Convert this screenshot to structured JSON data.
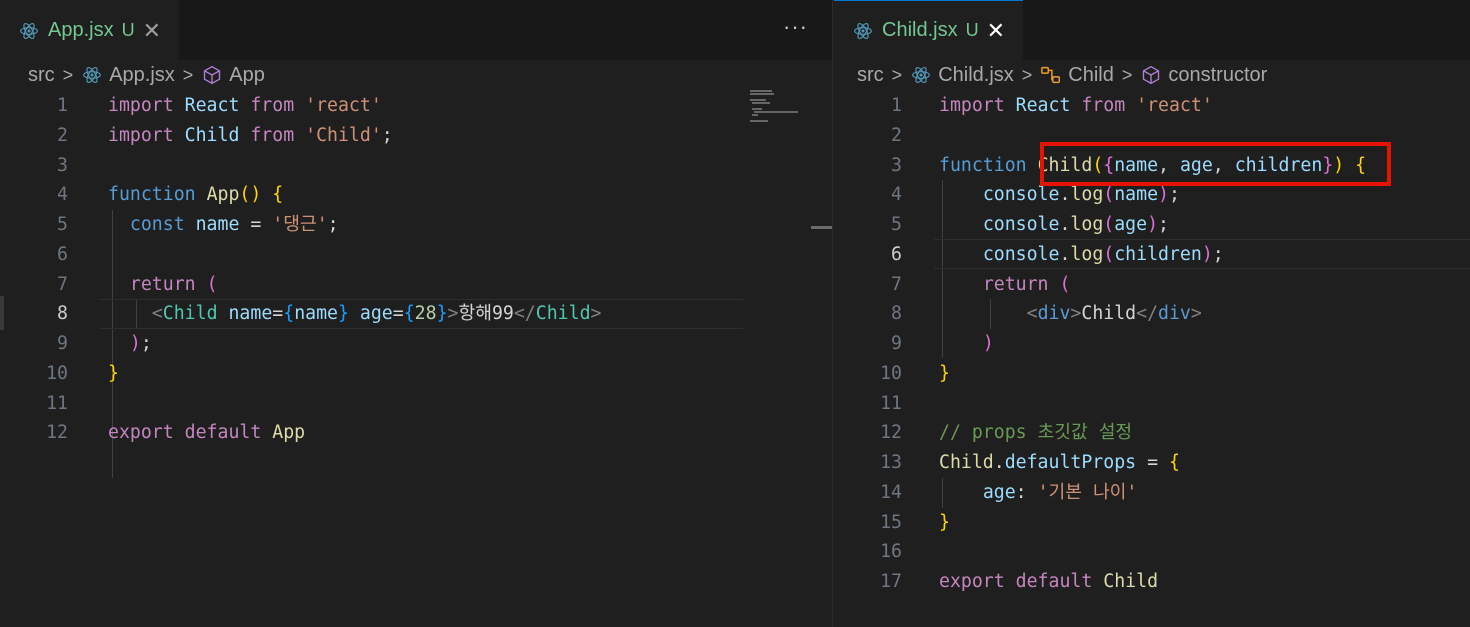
{
  "left": {
    "tab": {
      "name": "App.jsx",
      "status": "U",
      "close": "✕"
    },
    "more": "···",
    "breadcrumb": {
      "folder": "src",
      "file": "App.jsx",
      "symbol": "App"
    },
    "lines": [
      {
        "n": "1"
      },
      {
        "n": "2"
      },
      {
        "n": "3"
      },
      {
        "n": "4"
      },
      {
        "n": "5"
      },
      {
        "n": "6"
      },
      {
        "n": "7"
      },
      {
        "n": "8"
      },
      {
        "n": "9"
      },
      {
        "n": "10"
      },
      {
        "n": "11"
      },
      {
        "n": "12"
      }
    ],
    "code": {
      "l1": [
        "import",
        "React",
        "from",
        "'react'"
      ],
      "l2": [
        "import",
        "Child",
        "from",
        "'Child'",
        ";"
      ],
      "l4": [
        "function",
        "App",
        "()",
        "{"
      ],
      "l5": [
        "const",
        "name",
        "=",
        "'댕근'",
        ";"
      ],
      "l7": [
        "return",
        "("
      ],
      "l8": [
        "<",
        "Child",
        "name",
        "=",
        "{",
        "name",
        "}",
        "age",
        "=",
        "{",
        "28",
        "}",
        ">",
        "항해99",
        "</",
        "Child",
        ">"
      ],
      "l9": [
        ")",
        ";"
      ],
      "l10": [
        "}"
      ],
      "l12": [
        "export",
        "default",
        "App"
      ]
    }
  },
  "right": {
    "tab": {
      "name": "Child.jsx",
      "status": "U",
      "close": "✕"
    },
    "breadcrumb": {
      "folder": "src",
      "file": "Child.jsx",
      "symbol1": "Child",
      "symbol2": "constructor"
    },
    "lines": [
      {
        "n": "1"
      },
      {
        "n": "2"
      },
      {
        "n": "3"
      },
      {
        "n": "4"
      },
      {
        "n": "5"
      },
      {
        "n": "6"
      },
      {
        "n": "7"
      },
      {
        "n": "8"
      },
      {
        "n": "9"
      },
      {
        "n": "10"
      },
      {
        "n": "11"
      },
      {
        "n": "12"
      },
      {
        "n": "13"
      },
      {
        "n": "14"
      },
      {
        "n": "15"
      },
      {
        "n": "16"
      },
      {
        "n": "17"
      }
    ],
    "code": {
      "l1": [
        "import",
        "React",
        "from",
        "'react'"
      ],
      "l3": [
        "function",
        "Child",
        "(",
        "{",
        "name",
        ", ",
        "age",
        ", ",
        "children",
        "}",
        ")",
        "{"
      ],
      "l4": [
        "console",
        ".",
        "log",
        "(",
        "name",
        ")",
        ";"
      ],
      "l5": [
        "console",
        ".",
        "log",
        "(",
        "age",
        ")",
        ";"
      ],
      "l6": [
        "console",
        ".",
        "log",
        "(",
        "children",
        ")",
        ";"
      ],
      "l7": [
        "return",
        "("
      ],
      "l8": [
        "<",
        "div",
        ">",
        "Child",
        "</",
        "div",
        ">"
      ],
      "l9": [
        ")"
      ],
      "l10": [
        "}"
      ],
      "l12": [
        "// props 초깃값 설정"
      ],
      "l13": [
        "Child",
        ".",
        "defaultProps",
        "=",
        "{"
      ],
      "l14": [
        "age",
        ":",
        "'기본 나이'"
      ],
      "l15": [
        "}"
      ],
      "l17": [
        "export",
        "default",
        "Child"
      ]
    }
  },
  "colors": {
    "highlight_box": "#e51400",
    "active_tab_border": "#0078d4",
    "untracked": "#73c991"
  }
}
